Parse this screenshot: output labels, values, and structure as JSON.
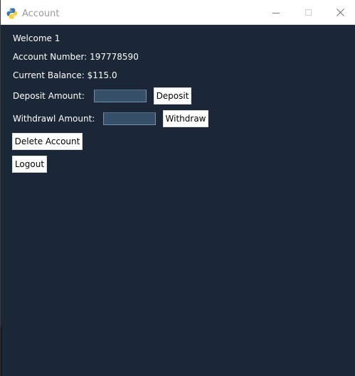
{
  "window": {
    "title": "Account",
    "controls": {
      "minimize_icon": "minimize-icon",
      "maximize_icon": "maximize-icon",
      "close_icon": "close-icon"
    }
  },
  "account": {
    "welcome": "Welcome 1",
    "account_number": "Account Number: 197778590",
    "current_balance": "Current Balance: $115.0"
  },
  "deposit": {
    "label": "Deposit Amount:",
    "value": "",
    "button": "Deposit"
  },
  "withdraw": {
    "label": "Withdrawl Amount:",
    "value": "",
    "button": "Withdraw"
  },
  "actions": {
    "delete_account": "Delete Account",
    "logout": "Logout"
  },
  "colors": {
    "background": "#1b2736",
    "entry_background": "#37506a",
    "text": "#ffffff",
    "titlebar": "#ffffff"
  }
}
